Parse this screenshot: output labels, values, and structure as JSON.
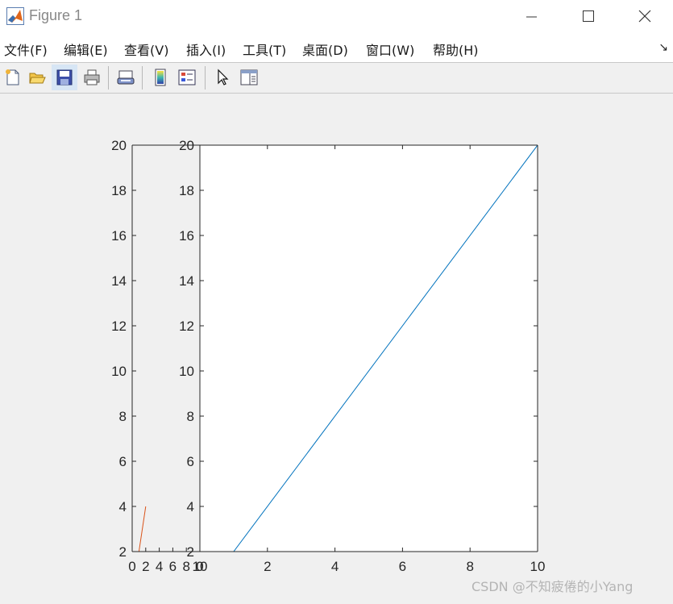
{
  "window": {
    "title": "Figure 1",
    "icon": "matlab-icon"
  },
  "menubar": {
    "items": [
      {
        "label": "文件(F)"
      },
      {
        "label": "编辑(E)"
      },
      {
        "label": "查看(V)"
      },
      {
        "label": "插入(I)"
      },
      {
        "label": "工具(T)"
      },
      {
        "label": "桌面(D)"
      },
      {
        "label": "窗口(W)"
      },
      {
        "label": "帮助(H)"
      }
    ],
    "dock_arrow": "↘"
  },
  "toolbar": {
    "buttons": [
      {
        "icon": "new-figure-icon"
      },
      {
        "icon": "open-file-icon"
      },
      {
        "icon": "save-icon"
      },
      {
        "icon": "print-icon"
      },
      {
        "icon": "link-plot-icon"
      },
      {
        "icon": "insert-colorbar-icon"
      },
      {
        "icon": "insert-legend-icon"
      },
      {
        "icon": "edit-plot-arrow-icon"
      },
      {
        "icon": "property-inspector-icon"
      }
    ]
  },
  "chart_data": [
    {
      "type": "line",
      "title": "",
      "xlabel": "",
      "ylabel": "",
      "xlim": [
        0,
        10
      ],
      "ylim": [
        2,
        20
      ],
      "xticks": [
        0,
        2,
        4,
        6,
        8,
        10
      ],
      "yticks": [
        2,
        4,
        6,
        8,
        10,
        12,
        14,
        16,
        18,
        20
      ],
      "grid": false,
      "series": [
        {
          "x": [
            1,
            10
          ],
          "y": [
            2,
            20
          ],
          "color": "#0072bd"
        }
      ]
    },
    {
      "type": "line",
      "title": "",
      "xlabel": "",
      "ylabel": "",
      "xlim": [
        0,
        10
      ],
      "ylim": [
        2,
        20
      ],
      "xticks": [
        0,
        2,
        4,
        6,
        8,
        10
      ],
      "yticks": [
        2,
        4,
        6,
        8,
        10,
        12,
        14,
        16,
        18,
        20
      ],
      "grid": false,
      "series": [
        {
          "x": [
            0,
            2
          ],
          "y": [
            0,
            4
          ],
          "color": "#d95319"
        }
      ]
    }
  ],
  "watermark": {
    "text": "CSDN @不知疲倦的小Yang"
  }
}
